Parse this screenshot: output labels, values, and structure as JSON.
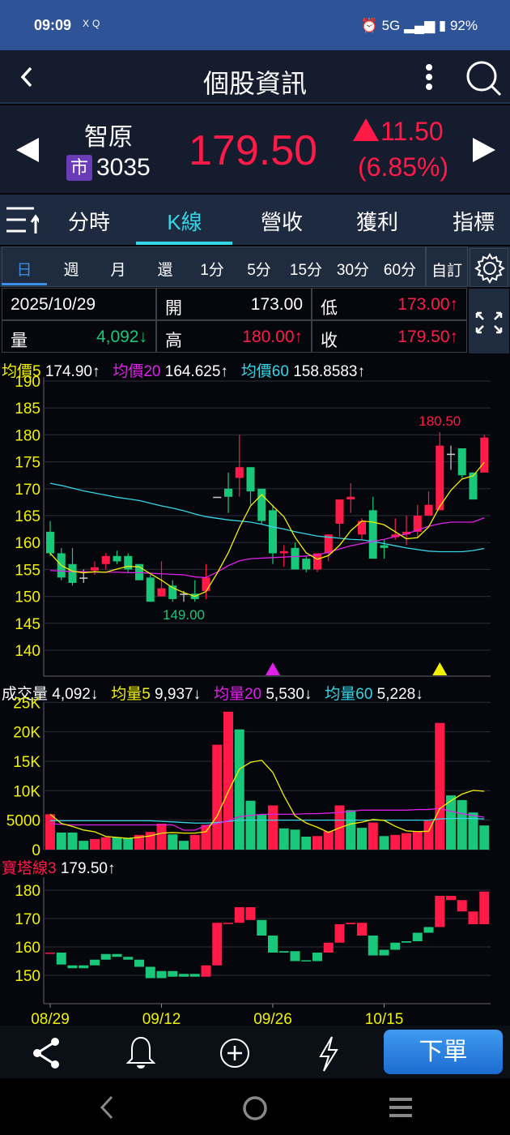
{
  "status": {
    "time": "09:09",
    "apps": "XQ",
    "battery": "92%",
    "network": "5G"
  },
  "header": {
    "title": "個股資訊"
  },
  "quote": {
    "name": "智原",
    "market_badge": "市",
    "code": "3035",
    "price": "179.50",
    "change": "11.50",
    "change_pct": "(6.85%)",
    "up_color": "#ff1a48",
    "down_color": "#19c77a"
  },
  "tabs": [
    {
      "label": "分時"
    },
    {
      "label": "K線",
      "active": true
    },
    {
      "label": "營收"
    },
    {
      "label": "獲利"
    },
    {
      "label": "指標"
    }
  ],
  "periods": [
    "日",
    "週",
    "月",
    "還",
    "1分",
    "5分",
    "15分",
    "30分",
    "60分"
  ],
  "custom_label": "自訂",
  "info": {
    "date": "2025/10/29",
    "open_label": "開",
    "open": "173.00",
    "low_label": "低",
    "low": "173.00↑",
    "vol_label": "量",
    "vol": "4,092↓",
    "high_label": "高",
    "high": "180.00↑",
    "close_label": "收",
    "close": "179.50↑"
  },
  "price_legend": {
    "ma5_label": "均價5",
    "ma5": "174.90↑",
    "ma20_label": "均價20",
    "ma20": "164.625↑",
    "ma60_label": "均價60",
    "ma60": "158.8583↑"
  },
  "volume_legend": {
    "label": "成交量",
    "value": "4,092↓",
    "ma5_label": "均量5",
    "ma5": "9,937↓",
    "ma20_label": "均量20",
    "ma20": "5,530↓",
    "ma60_label": "均量60",
    "ma60": "5,228↓"
  },
  "tower_legend": {
    "label": "寶塔線3",
    "value": "179.50↑"
  },
  "bottom": {
    "order_label": "下單"
  },
  "chart_data": {
    "type": "candlestick",
    "x_ticks": [
      {
        "index": 0,
        "label": "08/29"
      },
      {
        "index": 10,
        "label": "09/12"
      },
      {
        "index": 20,
        "label": "09/26"
      },
      {
        "index": 30,
        "label": "10/15"
      }
    ],
    "price": {
      "yticks": [
        190,
        185,
        180,
        175,
        170,
        165,
        160,
        155,
        150,
        145,
        140
      ],
      "ylim": [
        140,
        190
      ],
      "ohlc": [
        [
          162,
          164,
          157.5,
          158
        ],
        [
          158,
          159,
          153,
          153.5
        ],
        [
          156,
          159,
          152,
          152.5
        ],
        [
          153.5,
          155,
          152.5,
          153.5
        ],
        [
          154.8,
          156.5,
          154,
          155.4
        ],
        [
          156,
          158,
          155,
          157.5
        ],
        [
          157.5,
          158.5,
          156,
          156.5
        ],
        [
          157.5,
          158,
          154.5,
          155
        ],
        [
          156,
          156,
          153,
          153
        ],
        [
          153.5,
          154,
          149,
          149
        ],
        [
          150,
          156.5,
          150,
          151.5
        ],
        [
          152,
          153,
          149,
          149.5
        ],
        [
          150.5,
          151,
          149,
          150.5
        ],
        [
          150.5,
          153,
          149,
          149.5
        ],
        [
          151,
          156,
          149.5,
          153.5
        ],
        [
          168.5,
          168.5,
          168.5,
          168.5
        ],
        [
          170,
          173,
          165.5,
          168.5
        ],
        [
          172,
          180,
          168.5,
          174
        ],
        [
          174,
          174,
          167,
          169.5
        ],
        [
          170,
          170,
          163.5,
          164
        ],
        [
          166,
          167,
          156,
          158
        ],
        [
          158,
          159.5,
          155.5,
          158.4
        ],
        [
          159,
          160,
          155,
          155
        ],
        [
          157,
          157.5,
          154.5,
          155
        ],
        [
          155,
          158,
          154.5,
          158
        ],
        [
          158,
          161.5,
          156.5,
          161.5
        ],
        [
          163.5,
          168,
          161,
          168
        ],
        [
          168,
          171,
          165.5,
          168.5
        ],
        [
          161.5,
          164.5,
          160.5,
          164
        ],
        [
          166,
          168.5,
          157,
          157
        ],
        [
          159.5,
          160.5,
          157,
          159
        ],
        [
          161,
          164.5,
          160.5,
          161.5
        ],
        [
          161.5,
          165,
          159.5,
          162
        ],
        [
          162,
          167,
          161,
          165
        ],
        [
          165,
          169.5,
          165,
          167
        ],
        [
          166,
          180.5,
          166,
          178
        ],
        [
          176.5,
          178,
          173.5,
          176.5
        ],
        [
          177.5,
          177.5,
          172,
          172.5
        ],
        [
          173,
          173,
          168,
          168
        ],
        [
          173,
          180,
          173,
          179.5
        ]
      ],
      "ma20": [
        154.8,
        154.7,
        154.6,
        154.6,
        154.5,
        154.5,
        154.5,
        154.4,
        154.4,
        154.3,
        154.2,
        154.1,
        154,
        153.6,
        153.5,
        154.5,
        155.7,
        156.6,
        157,
        157.1,
        157.2,
        157.3,
        157.4,
        157.5,
        157.7,
        158.2,
        158.8,
        159.4,
        159.8,
        160.2,
        160.6,
        161.1,
        161.6,
        162.3,
        163,
        163.5,
        163.8,
        163.8,
        163.8,
        164.6
      ],
      "ma60": [
        171,
        170.6,
        170.1,
        169.6,
        169.2,
        168.8,
        168.4,
        168.1,
        167.8,
        167.3,
        166.8,
        166.4,
        165.9,
        165.3,
        164.8,
        164.5,
        164.2,
        164,
        163.8,
        163.4,
        162.9,
        162.5,
        162,
        161.6,
        161.2,
        161,
        160.8,
        160.6,
        160.5,
        160.2,
        159.8,
        159.4,
        159,
        158.7,
        158.4,
        158.3,
        158.3,
        158.3,
        158.5,
        158.9
      ],
      "high_label": "180.50",
      "high_index": 35,
      "low_label": "149.00",
      "low_index": 12,
      "signals": [
        {
          "index": 20,
          "color": "#e020e8"
        },
        {
          "index": 35,
          "color": "#f2f200"
        }
      ]
    },
    "volume": {
      "unit": "K",
      "yticks": [
        {
          "v": 25,
          "label": "25K"
        },
        {
          "v": 20,
          "label": "20K"
        },
        {
          "v": 15,
          "label": "15K"
        },
        {
          "v": 10,
          "label": "10K"
        },
        {
          "v": 5,
          "label": "5000"
        },
        {
          "v": 0,
          "label": "0"
        }
      ],
      "values": [
        6,
        2.9,
        2.9,
        1.5,
        1.8,
        2.1,
        2.1,
        2,
        2.5,
        3,
        4.4,
        2.6,
        1.5,
        2.5,
        4.2,
        17.8,
        23.4,
        20.4,
        8.3,
        5.9,
        7.5,
        3.6,
        3.4,
        2.2,
        2.3,
        3.1,
        7.5,
        6.7,
        3.7,
        4.6,
        2.3,
        2.5,
        2.8,
        3.1,
        4.9,
        21.5,
        9.2,
        8.4,
        6.3,
        4.1
      ],
      "colors": "rgggrrggrrrggrrrrgggrgggrrrggrgrrrrrgggg",
      "ma20": [
        4.4,
        4.3,
        4.2,
        4.2,
        4.2,
        4.2,
        4.2,
        4.2,
        4.2,
        4.2,
        4.2,
        4.2,
        3.3,
        3.3,
        4.1,
        4.4,
        4.9,
        5.6,
        5.8,
        6,
        6,
        6,
        6,
        6.1,
        6.1,
        6.2,
        6.3,
        6.5,
        6.7,
        6.7,
        6.7,
        6.7,
        6.7,
        6.8,
        6.8,
        7,
        6.5,
        6.1,
        5.8,
        5.5
      ],
      "ma60": [
        4.9,
        4.9,
        4.9,
        4.9,
        4.9,
        4.9,
        4.9,
        4.9,
        4.9,
        4.9,
        4.8,
        4.7,
        4.6,
        4.5,
        4.5,
        4.6,
        4.8,
        5,
        5,
        5,
        5,
        5,
        5,
        5,
        5,
        5,
        5,
        5,
        5,
        5,
        5,
        5,
        5,
        5,
        5,
        5.2,
        5.3,
        5.3,
        5.3,
        5.2
      ]
    },
    "tower": {
      "yticks": [
        180,
        170,
        160,
        150
      ],
      "ylim": [
        140,
        185
      ],
      "bars": [
        [
          158,
          158
        ],
        [
          158,
          153.8
        ],
        [
          153.5,
          152.5
        ],
        [
          153.5,
          152.5
        ],
        [
          155.5,
          153.5
        ],
        [
          157.5,
          155.5
        ],
        [
          157.5,
          156.5
        ],
        [
          156.5,
          155.5
        ],
        [
          155.5,
          153
        ],
        [
          153,
          149
        ],
        [
          151.5,
          149
        ],
        [
          151.5,
          149.5
        ],
        [
          150.5,
          149.5
        ],
        [
          150.5,
          149.5
        ],
        [
          153.5,
          149.5
        ],
        [
          168.5,
          153.5
        ],
        [
          168.5,
          168.5
        ],
        [
          174,
          168.5
        ],
        [
          174,
          169.5
        ],
        [
          169.5,
          164
        ],
        [
          164,
          158
        ],
        [
          158.5,
          158
        ],
        [
          158.5,
          155
        ],
        [
          155.3,
          155.3
        ],
        [
          158,
          155
        ],
        [
          161.5,
          158
        ],
        [
          168,
          161.5
        ],
        [
          168.5,
          168
        ],
        [
          168.5,
          164
        ],
        [
          164,
          157
        ],
        [
          159,
          157
        ],
        [
          161.5,
          159
        ],
        [
          162,
          161.5
        ],
        [
          165,
          162
        ],
        [
          167,
          165
        ],
        [
          178,
          167
        ],
        [
          178,
          176.5
        ],
        [
          176.5,
          172.5
        ],
        [
          172.5,
          168
        ],
        [
          179.5,
          168
        ]
      ],
      "colors": "rgggggggggggggrrrrrggggggrrrrggggggrrrrr"
    }
  }
}
